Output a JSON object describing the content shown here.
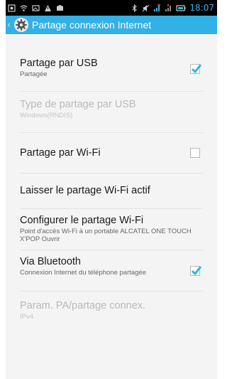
{
  "status_bar": {
    "time": "18:07",
    "icons": [
      "notification-icon",
      "wifi-icon",
      "gallery-icon",
      "warning-icon",
      "mail-icon",
      "bluetooth-icon",
      "mute-icon",
      "signal-icon",
      "signal-icon-2",
      "battery-icon"
    ]
  },
  "header": {
    "title": "Partage connexion Internet",
    "icon": "settings-gear-icon"
  },
  "settings": [
    {
      "title": "Partage par USB",
      "summary": "Partagée",
      "checkbox": true,
      "checked": true,
      "enabled": true
    },
    {
      "title": "Type de partage par USB",
      "summary": "Windows(RNDIS)",
      "checkbox": false,
      "enabled": false
    },
    {
      "title": "Partage par Wi-Fi",
      "summary": "",
      "checkbox": true,
      "checked": false,
      "enabled": true
    },
    {
      "title": "Laisser le partage Wi-Fi actif",
      "summary": "",
      "checkbox": false,
      "enabled": true
    },
    {
      "title": "Configurer le partage Wi-Fi",
      "summary": "Point d'accès Wi-Fi à un portable ALCATEL ONE TOUCH X'POP Ouvrir",
      "checkbox": false,
      "enabled": true
    },
    {
      "title": "Via Bluetooth",
      "summary": "Connexion Internet du téléphone partagée",
      "checkbox": true,
      "checked": true,
      "enabled": true
    },
    {
      "title": "Param. PA/partage connex.",
      "summary": "IPv4",
      "checkbox": false,
      "enabled": false
    }
  ],
  "colors": {
    "accent": "#33b0e6",
    "check": "#33b5e5",
    "status_bar_bg": "#000000",
    "background": "#f4f4f4"
  }
}
